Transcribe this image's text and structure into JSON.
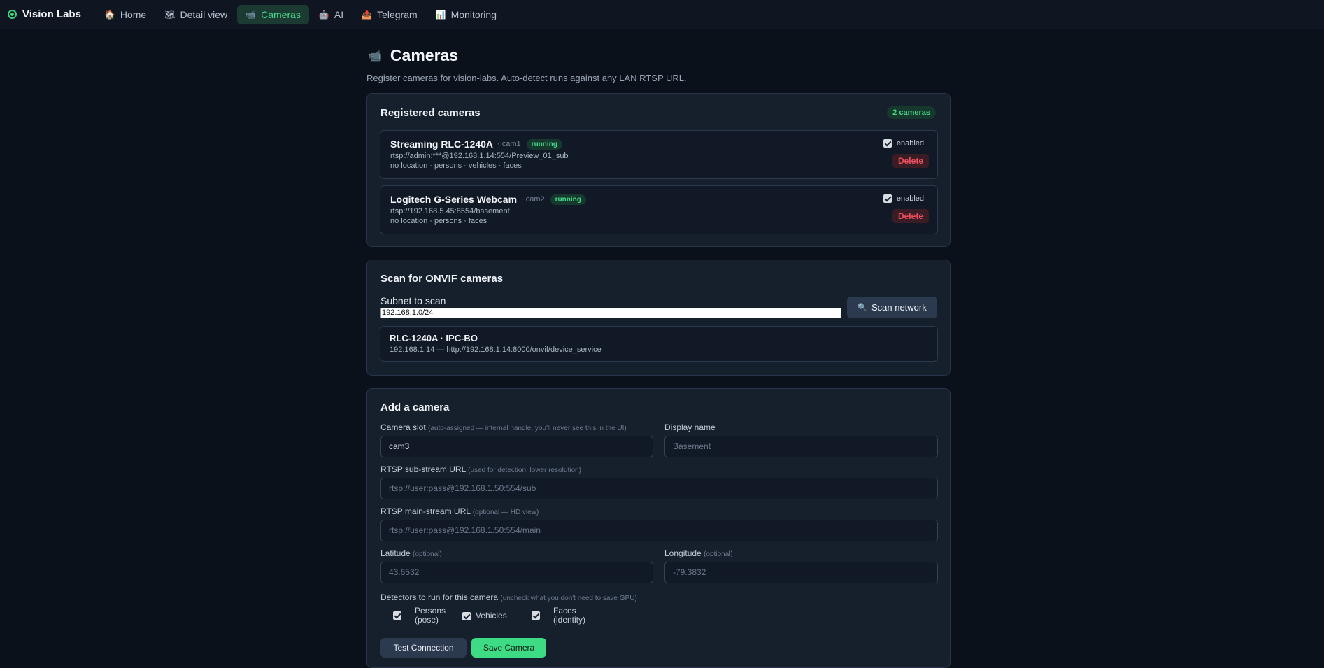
{
  "app": {
    "name": "Vision Labs"
  },
  "nav": {
    "tabs": [
      {
        "icon": "🏠",
        "label": "Home"
      },
      {
        "icon": "🗺",
        "label": "Detail view"
      },
      {
        "icon": "📹",
        "label": "Cameras"
      },
      {
        "icon": "🤖",
        "label": "AI"
      },
      {
        "icon": "📤",
        "label": "Telegram"
      },
      {
        "icon": "📊",
        "label": "Monitoring"
      }
    ],
    "active": "Cameras"
  },
  "page": {
    "icon": "📹",
    "title": "Cameras",
    "subtitle": "Register cameras for vision-labs. Auto-detect runs against any LAN RTSP URL."
  },
  "registered": {
    "title": "Registered cameras",
    "count_label": "2 cameras",
    "cameras": [
      {
        "name": "Streaming RLC-1240A",
        "slot": "· cam1",
        "status": "running",
        "url": "rtsp://admin:***@192.168.1.14:554/Preview_01_sub",
        "meta": "no location · persons · vehicles · faces",
        "enabled_label": "enabled",
        "enabled": true,
        "delete_label": "Delete"
      },
      {
        "name": "Logitech G-Series Webcam",
        "slot": "· cam2",
        "status": "running",
        "url": "rtsp://192.168.5.45:8554/basement",
        "meta": "no location · persons · faces",
        "enabled_label": "enabled",
        "enabled": true,
        "delete_label": "Delete"
      }
    ]
  },
  "scan": {
    "title": "Scan for ONVIF cameras",
    "subnet_label": "Subnet to scan",
    "subnet_value": "192.168.1.0/24",
    "button_icon": "🔍",
    "button_label": "Scan network",
    "results": [
      {
        "name": "RLC-1240A · IPC-BO",
        "address": "192.168.1.14 — http://192.168.1.14:8000/onvif/device_service"
      }
    ]
  },
  "add": {
    "title": "Add a camera",
    "slot_label": "Camera slot",
    "slot_hint": "(auto-assigned — internal handle, you'll never see this in the UI)",
    "slot_value": "cam3",
    "display_label": "Display name",
    "display_placeholder": "Basement",
    "sub_label": "RTSP sub-stream URL",
    "sub_hint": "(used for detection, lower resolution)",
    "sub_placeholder": "rtsp://user:pass@192.168.1.50:554/sub",
    "main_label": "RTSP main-stream URL",
    "main_hint": "(optional — HD view)",
    "main_placeholder": "rtsp://user:pass@192.168.1.50:554/main",
    "lat_label": "Latitude",
    "lat_hint": "(optional)",
    "lat_placeholder": "43.6532",
    "lon_label": "Longitude",
    "lon_hint": "(optional)",
    "lon_placeholder": "-79.3832",
    "detectors_label": "Detectors to run for this camera",
    "detectors_hint": "(uncheck what you don't need to save GPU)",
    "detectors": [
      {
        "line1": "Persons",
        "line2": "(pose)",
        "checked": true
      },
      {
        "line1": "Vehicles",
        "line2": "",
        "checked": true
      },
      {
        "line1": "Faces",
        "line2": "(identity)",
        "checked": true
      }
    ],
    "test_label": "Test Connection",
    "save_label": "Save Camera"
  },
  "colors": {
    "accent": "#3ddc84",
    "danger": "#ef4f5f",
    "background": "#0b111a",
    "card": "#161f2c"
  }
}
